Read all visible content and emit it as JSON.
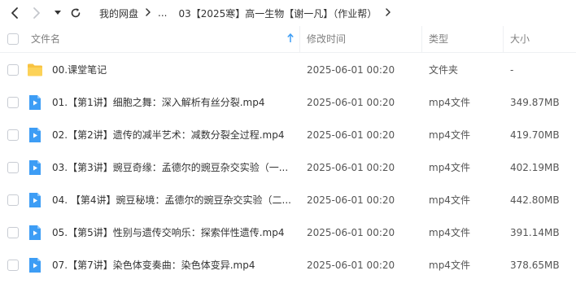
{
  "breadcrumb": {
    "root": "我的网盘",
    "ellipsis": "...",
    "current": "03【2025寒】高一生物【谢一凡】（作业帮）"
  },
  "columns": {
    "name": "文件名",
    "modified": "修改时间",
    "type": "类型",
    "size": "大小"
  },
  "files": [
    {
      "name": "00.课堂笔记",
      "modified": "2025-06-01 00:20",
      "type": "文件夹",
      "size": "-",
      "icon": "folder-icon"
    },
    {
      "name": "01.【第1讲】细胞之舞：深入解析有丝分裂.mp4",
      "modified": "2025-06-01 00:20",
      "type": "mp4文件",
      "size": "349.87MB",
      "icon": "video-file-icon"
    },
    {
      "name": "02.【第2讲】遗传的减半艺术：减数分裂全过程.mp4",
      "modified": "2025-06-01 00:20",
      "type": "mp4文件",
      "size": "419.70MB",
      "icon": "video-file-icon"
    },
    {
      "name": "03.【第3讲】豌豆奇缘：孟德尔的豌豆杂交实验（一...",
      "modified": "2025-06-01 00:20",
      "type": "mp4文件",
      "size": "402.19MB",
      "icon": "video-file-icon"
    },
    {
      "name": "04. 【第4讲】豌豆秘境：孟德尔的豌豆杂交实验（二...",
      "modified": "2025-06-01 00:20",
      "type": "mp4文件",
      "size": "442.80MB",
      "icon": "video-file-icon"
    },
    {
      "name": "05.【第5讲】性别与遗传交响乐：探索伴性遗传.mp4",
      "modified": "2025-06-01 00:20",
      "type": "mp4文件",
      "size": "391.14MB",
      "icon": "video-file-icon"
    },
    {
      "name": "07.【第7讲】染色体变奏曲：染色体变异.mp4",
      "modified": "2025-06-01 00:20",
      "type": "mp4文件",
      "size": "378.65MB",
      "icon": "video-file-icon"
    }
  ],
  "colors": {
    "folder": "#f8c341",
    "video": "#3d9df5",
    "sort_arrow": "#3d9df5",
    "muted": "#808080"
  }
}
